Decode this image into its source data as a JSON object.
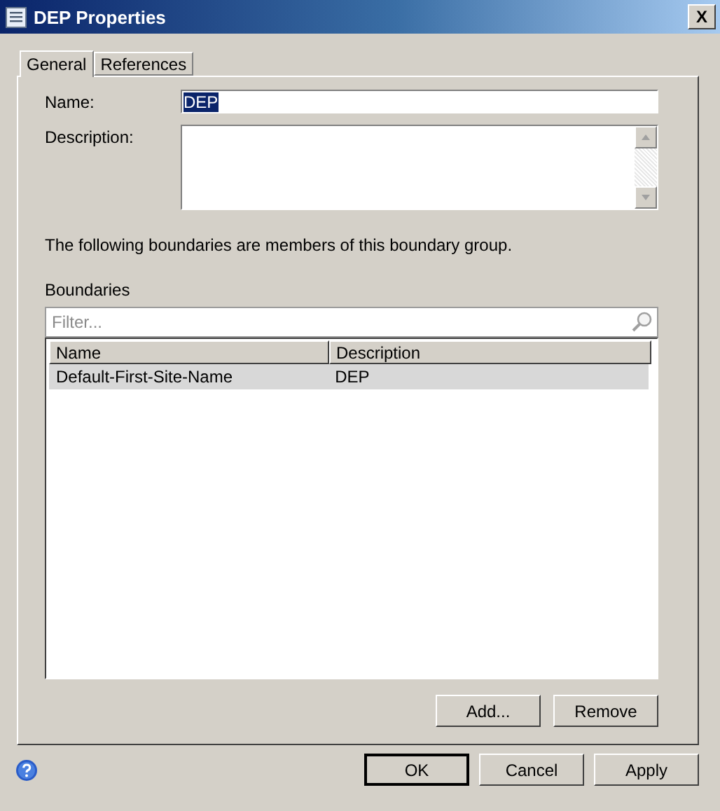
{
  "window": {
    "title": "DEP Properties",
    "close": "X"
  },
  "tabs": [
    {
      "label": "General",
      "selected": true
    },
    {
      "label": "References",
      "selected": false
    }
  ],
  "name_field": {
    "label": "Name:",
    "value": "DEP",
    "text_selected": true
  },
  "description_field": {
    "label": "Description:"
  },
  "info_text": "The following boundaries are members of this boundary group.",
  "boundaries": {
    "label": "Boundaries",
    "filter": {
      "placeholder": "Filter..."
    },
    "columns": [
      "Name",
      "Description"
    ],
    "rows": [
      {
        "cells": [
          "Default-First-Site-Name",
          "DEP"
        ],
        "selected": true
      }
    ],
    "buttons": [
      "Add...",
      "Remove"
    ]
  },
  "footer_buttons": [
    {
      "label": "OK",
      "default": true
    },
    {
      "label": "Cancel",
      "default": false
    },
    {
      "label": "Apply",
      "default": false
    }
  ]
}
